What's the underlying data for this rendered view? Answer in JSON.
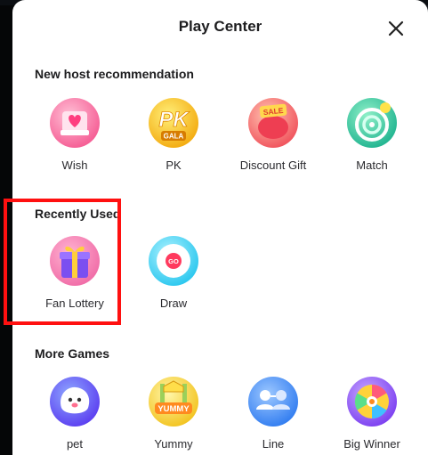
{
  "sheet": {
    "title": "Play Center",
    "close_icon": "close-icon"
  },
  "sections": {
    "new_host": {
      "title": "New host recommendation",
      "items": [
        {
          "label": "Wish",
          "icon": "wish-icon"
        },
        {
          "label": "PK",
          "icon": "pk-gala-icon"
        },
        {
          "label": "Discount Gift",
          "icon": "sale-gift-icon"
        },
        {
          "label": "Match",
          "icon": "match-icon"
        }
      ]
    },
    "recent": {
      "title": "Recently Used",
      "items": [
        {
          "label": "Fan Lottery",
          "icon": "gift-box-icon"
        },
        {
          "label": "Draw",
          "icon": "draw-go-icon"
        }
      ]
    },
    "more_games": {
      "title": "More Games",
      "items": [
        {
          "label": "pet",
          "icon": "pet-icon"
        },
        {
          "label": "Yummy",
          "icon": "yummy-icon"
        },
        {
          "label": "Line",
          "icon": "line-icon"
        },
        {
          "label": "Big Winner",
          "icon": "wheel-icon"
        }
      ]
    }
  },
  "icon_text": {
    "pk": "PK",
    "gala": "GALA",
    "sale": "SALE",
    "go": "GO",
    "yummy": "YUMMY"
  },
  "colors": {
    "highlight": "#ff1010",
    "text": "#1d1d1f"
  }
}
